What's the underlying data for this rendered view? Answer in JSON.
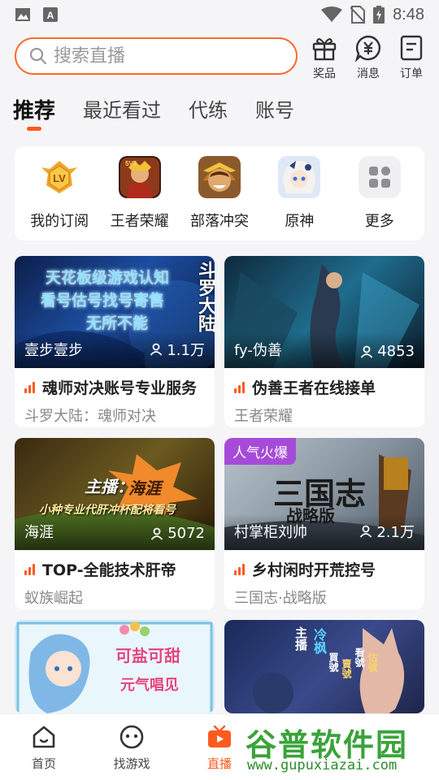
{
  "status_bar": {
    "time": "8:48"
  },
  "search": {
    "placeholder": "搜索直播"
  },
  "header_buttons": [
    {
      "label": "奖品",
      "icon": "gift-icon"
    },
    {
      "label": "消息",
      "icon": "message-yen-icon"
    },
    {
      "label": "订单",
      "icon": "order-icon"
    }
  ],
  "tabs": [
    {
      "label": "推荐",
      "active": true
    },
    {
      "label": "最近看过"
    },
    {
      "label": "代练"
    },
    {
      "label": "账号"
    }
  ],
  "quick_links": [
    {
      "label": "我的订阅",
      "icon": "lv-badge-icon"
    },
    {
      "label": "王者荣耀",
      "icon": "honor-of-kings-icon"
    },
    {
      "label": "部落冲突",
      "icon": "clash-of-clans-icon"
    },
    {
      "label": "原神",
      "icon": "genshin-icon"
    },
    {
      "label": "更多",
      "icon": "grid-more-icon"
    }
  ],
  "streams": [
    {
      "anchor": "壹步壹步",
      "viewers": "1.1万",
      "title": "魂师对决账号专业服务",
      "game": "斗罗大陆：魂师对决",
      "thumb_text": [
        "天花板级游戏认知",
        "看号估号找号寄售",
        "无所不能",
        "斗罗大陆"
      ]
    },
    {
      "anchor": "fy-伪善",
      "viewers": "4853",
      "title": "伪善王者在线接单",
      "game": "王者荣耀"
    },
    {
      "anchor": "海涯",
      "viewers": "5072",
      "title": "TOP-全能技术肝帝",
      "game": "蚁族崛起",
      "thumb_text": [
        "主播：",
        "海涯",
        "小种专业代肝冲杯配将看号"
      ]
    },
    {
      "anchor": "村掌柜刘帅",
      "viewers": "2.1万",
      "title": "乡村闲时开荒控号",
      "game": "三国志·战略版",
      "badge": "人气火爆",
      "thumb_text": [
        "三国志",
        "战略版"
      ]
    },
    {
      "anchor": "",
      "viewers": "",
      "title": "",
      "game": "",
      "thumb_text": [
        "可盐可甜",
        "元气唱见"
      ]
    },
    {
      "anchor": "",
      "viewers": "",
      "title": "",
      "game": "",
      "thumb_text": [
        "主播",
        "冷枫",
        "買號",
        "賣號",
        "看號",
        "估號"
      ]
    }
  ],
  "bottom_nav": [
    {
      "label": "首页",
      "icon": "home-icon"
    },
    {
      "label": "找游戏",
      "icon": "gamepad-icon"
    },
    {
      "label": "直播",
      "icon": "tv-icon",
      "active": true
    }
  ],
  "watermark": {
    "main": "谷普软件园",
    "url": "www.gupuxiazai.com"
  },
  "colors": {
    "accent": "#ff5a1f",
    "hot_badge": "#a64bd8",
    "watermark": "#3aa33a"
  }
}
